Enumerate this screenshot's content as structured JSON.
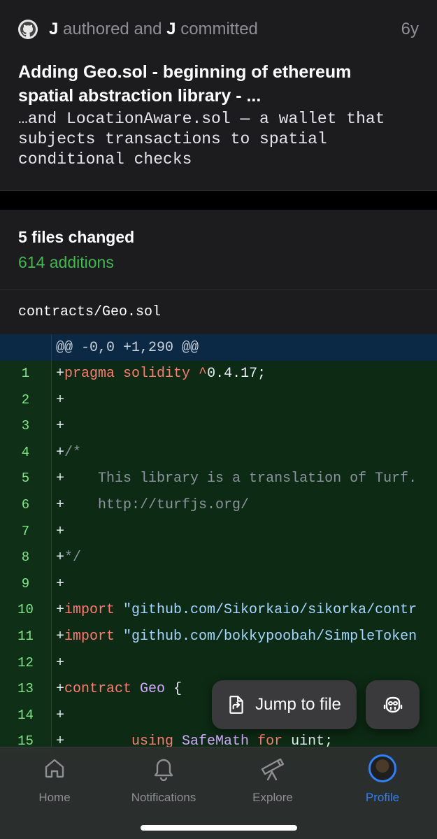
{
  "commit": {
    "author_name": "J",
    "authored_text": "authored and",
    "committer_name": "J",
    "committed_text": "committed",
    "age": "6y",
    "title": "Adding Geo.sol - beginning of ethereum spatial abstraction library - ...",
    "body": "…and LocationAware.sol — a wallet that subjects transactions to spatial conditional checks"
  },
  "summary": {
    "files_changed": "5 files changed",
    "additions": "614 additions"
  },
  "file": {
    "name": "contracts/Geo.sol",
    "hunk": "@@ -0,0 +1,290 @@"
  },
  "diff_lines": [
    {
      "n": "1",
      "tokens": [
        {
          "t": "+"
        },
        {
          "t": "pragma solidity ^",
          "c": "kw"
        },
        {
          "t": "0.4.17;"
        }
      ]
    },
    {
      "n": "2",
      "tokens": [
        {
          "t": "+"
        }
      ]
    },
    {
      "n": "3",
      "tokens": [
        {
          "t": "+"
        }
      ]
    },
    {
      "n": "4",
      "tokens": [
        {
          "t": "+"
        },
        {
          "t": "/*",
          "c": "cm"
        }
      ]
    },
    {
      "n": "5",
      "tokens": [
        {
          "t": "+"
        },
        {
          "t": "    This library is a translation of Turf.",
          "c": "cm"
        }
      ]
    },
    {
      "n": "6",
      "tokens": [
        {
          "t": "+"
        },
        {
          "t": "    http://turfjs.org/",
          "c": "cm"
        }
      ]
    },
    {
      "n": "7",
      "tokens": [
        {
          "t": "+"
        }
      ]
    },
    {
      "n": "8",
      "tokens": [
        {
          "t": "+"
        },
        {
          "t": "*/",
          "c": "cm"
        }
      ]
    },
    {
      "n": "9",
      "tokens": [
        {
          "t": "+"
        }
      ]
    },
    {
      "n": "10",
      "tokens": [
        {
          "t": "+"
        },
        {
          "t": "import ",
          "c": "kw"
        },
        {
          "t": "\"github.com/Sikorkaio/sikorka/contr",
          "c": "str"
        }
      ]
    },
    {
      "n": "11",
      "tokens": [
        {
          "t": "+"
        },
        {
          "t": "import ",
          "c": "kw"
        },
        {
          "t": "\"github.com/bokkypoobah/SimpleToken",
          "c": "str"
        }
      ]
    },
    {
      "n": "12",
      "tokens": [
        {
          "t": "+"
        }
      ]
    },
    {
      "n": "13",
      "tokens": [
        {
          "t": "+"
        },
        {
          "t": "contract ",
          "c": "kw"
        },
        {
          "t": "Geo",
          "c": "ty"
        },
        {
          "t": " {"
        }
      ]
    },
    {
      "n": "14",
      "tokens": [
        {
          "t": "+"
        }
      ]
    },
    {
      "n": "15",
      "tokens": [
        {
          "t": "+"
        },
        {
          "t": "        "
        },
        {
          "t": "using ",
          "c": "kw"
        },
        {
          "t": "SafeMath",
          "c": "ty"
        },
        {
          "t": " "
        },
        {
          "t": "for ",
          "c": "kw"
        },
        {
          "t": "uint;"
        }
      ]
    }
  ],
  "floating": {
    "jump_label": "Jump to file"
  },
  "tabs": [
    {
      "label": "Home",
      "icon": "home-icon"
    },
    {
      "label": "Notifications",
      "icon": "bell-icon"
    },
    {
      "label": "Explore",
      "icon": "telescope-icon"
    },
    {
      "label": "Profile",
      "icon": "avatar"
    }
  ],
  "colors": {
    "accent": "#2f81f7",
    "additions": "#3fb950",
    "diff_added_bg": "#0d2a14",
    "hunk_bg": "#0b2844"
  }
}
